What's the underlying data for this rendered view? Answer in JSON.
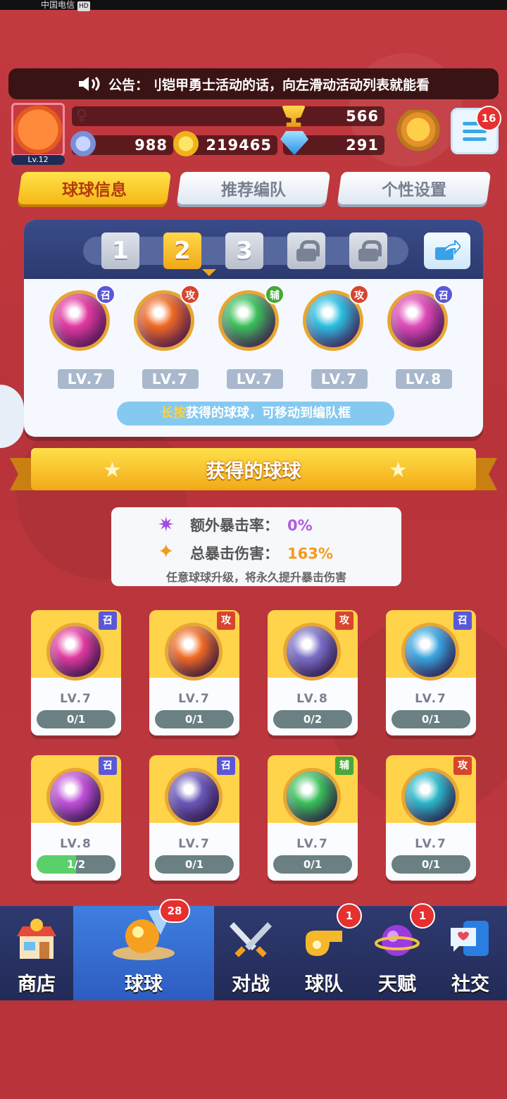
{
  "status_bar": {
    "carrier": "中国电信",
    "hd": "HD"
  },
  "announcement": {
    "prefix": "公告：",
    "text": "刂铠甲勇士活动的话，向左滑动活动列表就能看"
  },
  "profile": {
    "level": "Lv.12",
    "trophies": "566",
    "tickets": "988",
    "gold": "219465",
    "gems": "291",
    "menu_badge": "16"
  },
  "tabs": [
    {
      "label": "球球信息",
      "active": true
    },
    {
      "label": "推荐编队",
      "active": false
    },
    {
      "label": "个性设置",
      "active": false
    }
  ],
  "team_slots": [
    {
      "label": "1",
      "state": "inactive"
    },
    {
      "label": "2",
      "state": "active"
    },
    {
      "label": "3",
      "state": "inactive"
    },
    {
      "label": "",
      "state": "locked"
    },
    {
      "label": "",
      "state": "locked"
    }
  ],
  "team_balls": [
    {
      "level": "LV.7",
      "tag": "召",
      "tag_type": "summon",
      "color": "#e23aa0",
      "icon": "phoenix-icon"
    },
    {
      "level": "LV.7",
      "tag": "攻",
      "tag_type": "attack",
      "color": "#f06a22",
      "icon": "claw-icon"
    },
    {
      "level": "LV.7",
      "tag": "辅",
      "tag_type": "support",
      "color": "#3ac05a",
      "icon": "arrow-up-icon"
    },
    {
      "level": "LV.7",
      "tag": "攻",
      "tag_type": "attack",
      "color": "#2ac0e0",
      "icon": "arrows-icon"
    },
    {
      "level": "LV.8",
      "tag": "召",
      "tag_type": "summon",
      "color": "#e04ab8",
      "icon": "dagger-icon"
    }
  ],
  "team_hint": {
    "highlight": "长按",
    "text": "获得的球球，可移动到编队框"
  },
  "section_title": "获得的球球",
  "crit_info": {
    "extra_crit_label": "额外暴击率：",
    "extra_crit_value": "0%",
    "total_crit_label": "总暴击伤害：",
    "total_crit_value": "163%",
    "note": "任意球球升级，将永久提升暴击伤害"
  },
  "owned_balls": [
    {
      "level": "LV.7",
      "progress": "0/1",
      "fraction": 0,
      "tag": "召",
      "tag_type": "summon",
      "color": "#e23aa0"
    },
    {
      "level": "LV.7",
      "progress": "0/1",
      "fraction": 0,
      "tag": "攻",
      "tag_type": "attack",
      "color": "#f06a22"
    },
    {
      "level": "LV.8",
      "progress": "0/2",
      "fraction": 0,
      "tag": "攻",
      "tag_type": "attack",
      "color": "#7a70c8"
    },
    {
      "level": "LV.7",
      "progress": "0/1",
      "fraction": 0,
      "tag": "召",
      "tag_type": "summon",
      "color": "#3aa6e0"
    },
    {
      "level": "LV.8",
      "progress": "1/2",
      "fraction": 0.5,
      "tag": "召",
      "tag_type": "summon",
      "color": "#c050d8"
    },
    {
      "level": "LV.7",
      "progress": "0/1",
      "fraction": 0,
      "tag": "召",
      "tag_type": "summon",
      "color": "#6a58b8"
    },
    {
      "level": "LV.7",
      "progress": "0/1",
      "fraction": 0,
      "tag": "辅",
      "tag_type": "support",
      "color": "#3ac05a"
    },
    {
      "level": "LV.7",
      "progress": "0/1",
      "fraction": 0,
      "tag": "攻",
      "tag_type": "attack",
      "color": "#2ab8c8"
    }
  ],
  "bottom_nav": [
    {
      "label": "商店",
      "icon": "shop-icon",
      "badge": ""
    },
    {
      "label": "球球",
      "icon": "ball-icon",
      "badge": "28",
      "active": true
    },
    {
      "label": "对战",
      "icon": "crossed-swords-icon",
      "badge": ""
    },
    {
      "label": "球队",
      "icon": "whistle-icon",
      "badge": "1"
    },
    {
      "label": "天赋",
      "icon": "planet-icon",
      "badge": "1"
    },
    {
      "label": "社交",
      "icon": "chat-icon",
      "badge": ""
    }
  ]
}
